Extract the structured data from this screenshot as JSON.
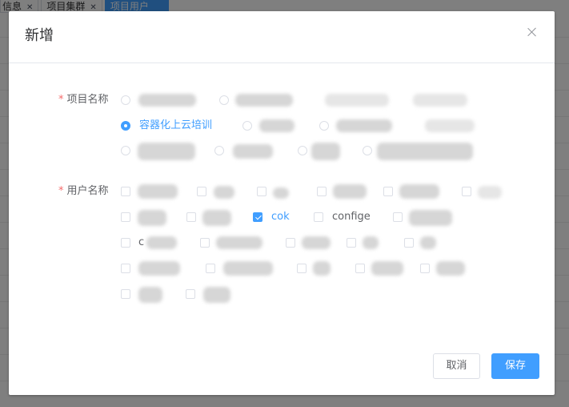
{
  "background": {
    "tabs": [
      {
        "label": "信息"
      },
      {
        "label": "项目集群"
      },
      {
        "label": "项目用户"
      }
    ]
  },
  "dialog": {
    "title": "新增",
    "project_field": {
      "required_mark": "*",
      "label": "项目名称",
      "selected_option": "容器化上云培训"
    },
    "user_field": {
      "required_mark": "*",
      "label": "用户名称",
      "options": {
        "cok": {
          "label": "cok",
          "checked": true
        },
        "confige": {
          "label": "confige",
          "checked": false
        },
        "partial_c": {
          "label": "c"
        }
      }
    },
    "buttons": {
      "cancel": "取消",
      "save": "保存"
    }
  },
  "colors": {
    "primary": "#409eff",
    "required": "#f56c6c",
    "overlay": "rgba(0,0,0,0.5)"
  }
}
